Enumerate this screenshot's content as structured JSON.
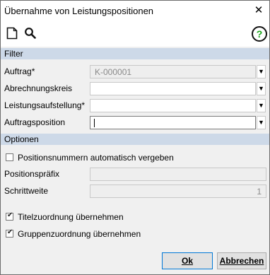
{
  "window": {
    "title": "Übernahme von Leistungspositionen",
    "close_glyph": "✕"
  },
  "toolbar": {
    "icons": [
      "new-document-icon",
      "search-icon"
    ],
    "help_glyph": "?"
  },
  "sections": {
    "filter": "Filter",
    "options": "Optionen"
  },
  "filter": {
    "auftrag": {
      "label": "Auftrag*",
      "value": "K-000001",
      "disabled": true
    },
    "abrechnungskreis": {
      "label": "Abrechnungskreis",
      "value": ""
    },
    "leistungsaufstellung": {
      "label": "Leistungsaufstellung*",
      "value": ""
    },
    "auftragsposition": {
      "label": "Auftragsposition",
      "value": ""
    }
  },
  "options": {
    "auto_number": {
      "label": "Positionsnummern automatisch vergeben",
      "checked": false
    },
    "praefix": {
      "label": "Positionspräfix",
      "value": ""
    },
    "schrittweite": {
      "label": "Schrittweite",
      "value": "1"
    },
    "titel": {
      "label": "Titelzuordnung übernehmen",
      "checked": true
    },
    "gruppe": {
      "label": "Gruppenzuordnung übernehmen",
      "checked": true
    }
  },
  "buttons": {
    "ok": "Ok",
    "cancel": "Abbrechen"
  },
  "colors": {
    "section_bg": "#cdd9e8",
    "help_accent": "#1aa51a",
    "ok_border": "#0078d7"
  }
}
